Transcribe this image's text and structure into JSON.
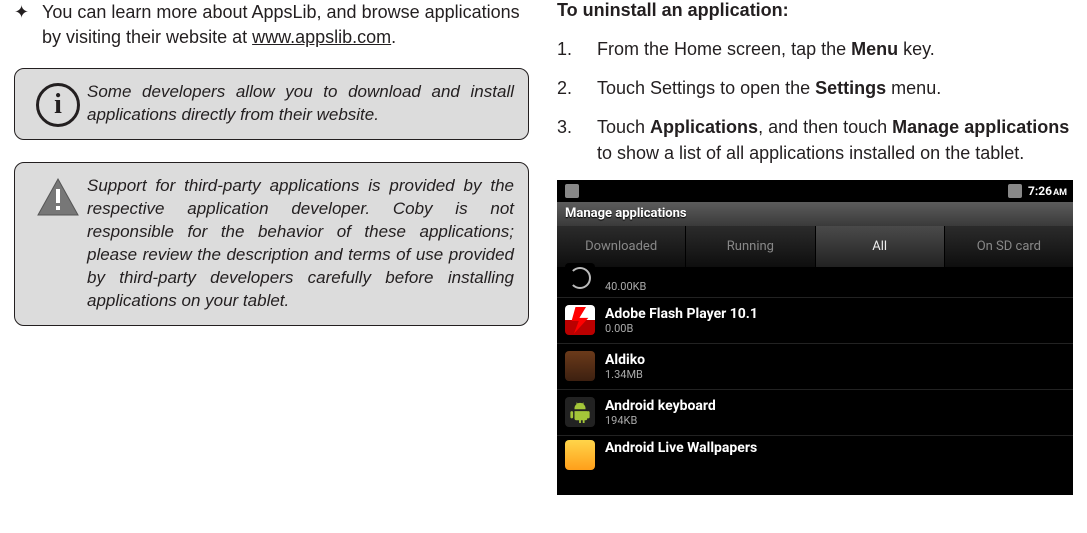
{
  "left": {
    "bullet": {
      "text_pre": "You can learn more about AppsLib, and browse applications by visiting their website at ",
      "link": "www.appslib.com",
      "text_post": "."
    },
    "info_note": "Some developers allow you to download and install applications directly from their website.",
    "warn_note": "Support for third-party applications is provided by the respective application developer. Coby is not responsible for the behavior of these applications; please review the description and terms of use provided by third-party developers carefully before installing applications on your tablet."
  },
  "right": {
    "heading": "To uninstall an application:",
    "steps": [
      {
        "num": "1.",
        "pre": "From the Home screen, tap the ",
        "b1": "Menu",
        "mid": " key.",
        "b2": "",
        "post": ""
      },
      {
        "num": "2.",
        "pre": "Touch Settings to open the ",
        "b1": "Settings",
        "mid": " menu.",
        "b2": "",
        "post": ""
      },
      {
        "num": "3.",
        "pre": "Touch ",
        "b1": "Applications",
        "mid": ", and then touch ",
        "b2": "Manage applications",
        "post": " to show a list of all applications installed on the tablet."
      }
    ]
  },
  "screenshot": {
    "time_num": "7:26",
    "time_ampm": "AM",
    "title": "Manage applications",
    "tabs": [
      "Downloaded",
      "Running",
      "All",
      "On SD card"
    ],
    "selected_tab_index": 2,
    "rows": [
      {
        "name": "",
        "size": "40.00KB",
        "top_cut": true
      },
      {
        "name": "Adobe Flash Player 10.1",
        "size": "0.00B"
      },
      {
        "name": "Aldiko",
        "size": "1.34MB"
      },
      {
        "name": "Android keyboard",
        "size": "194KB"
      },
      {
        "name": "Android Live Wallpapers",
        "size": "",
        "bottom_cut": true
      }
    ]
  }
}
